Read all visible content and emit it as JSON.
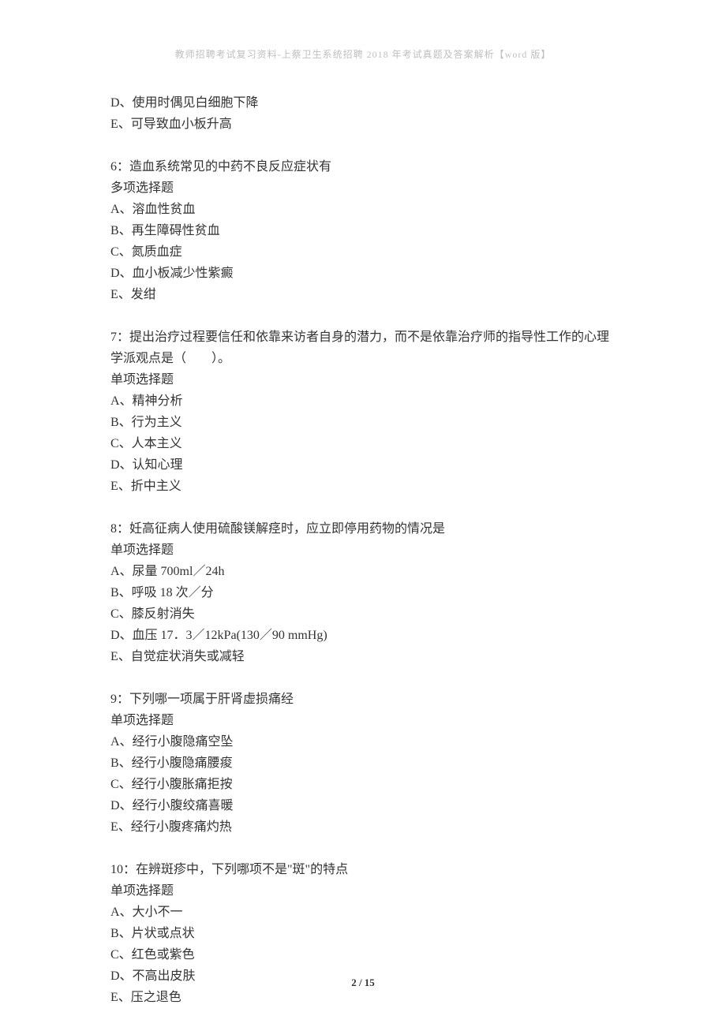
{
  "header": "教师招聘考试复习资料-上蔡卫生系统招聘 2018 年考试真题及答案解析【word 版】",
  "footer": "2 / 15",
  "q5_tail": {
    "lines": [
      "D、使用时偶见白细胞下降",
      "E、可导致血小板升高"
    ]
  },
  "q6": {
    "stem": "6：造血系统常见的中药不良反应症状有",
    "type": "多项选择题",
    "options": [
      "A、溶血性贫血",
      "B、再生障碍性贫血",
      "C、氮质血症",
      "D、血小板减少性紫癜",
      "E、发绀"
    ]
  },
  "q7": {
    "stem_line1": "7：提出治疗过程要信任和依靠来访者自身的潜力，而不是依靠治疗师的指导性工作的心理",
    "stem_line2": "学派观点是（　　）。",
    "type": "单项选择题",
    "options": [
      "A、精神分析",
      "B、行为主义",
      "C、人本主义",
      "D、认知心理",
      "E、折中主义"
    ]
  },
  "q8": {
    "stem": "8：妊高征病人使用硫酸镁解痉时，应立即停用药物的情况是",
    "type": "单项选择题",
    "options": [
      "A、尿量 700ml／24h",
      "B、呼吸 18 次／分",
      "C、膝反射消失",
      "D、血压 17．3／12kPa(130／90 mmHg)",
      "E、自觉症状消失或减轻"
    ]
  },
  "q9": {
    "stem": "9：下列哪一项属于肝肾虚损痛经",
    "type": "单项选择题",
    "options": [
      "A、经行小腹隐痛空坠",
      "B、经行小腹隐痛腰痠",
      "C、经行小腹胀痛拒按",
      "D、经行小腹绞痛喜暖",
      "E、经行小腹疼痛灼热"
    ]
  },
  "q10": {
    "stem": "10：在辨斑疹中，下列哪项不是\"斑\"的特点",
    "type": "单项选择题",
    "options": [
      "A、大小不一",
      "B、片状或点状",
      "C、红色或紫色",
      "D、不高出皮肤",
      "E、压之退色"
    ]
  }
}
